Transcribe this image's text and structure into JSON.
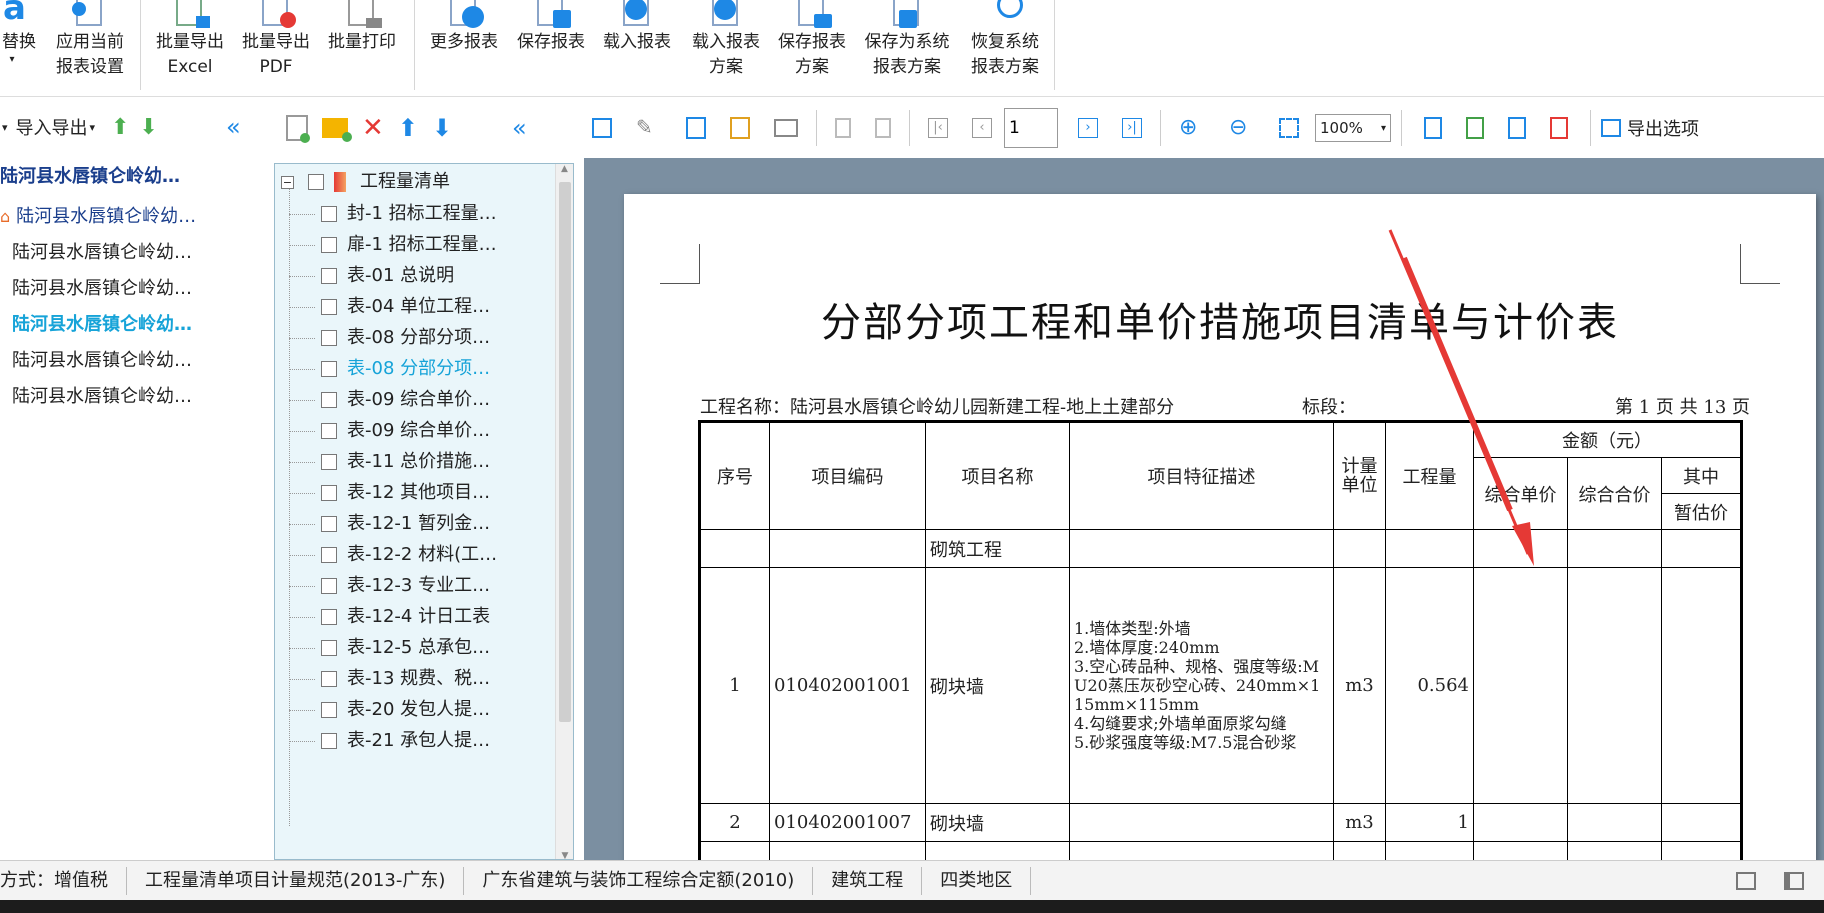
{
  "ribbon": {
    "buttons": [
      {
        "label1": "替换",
        "label2": "▾"
      },
      {
        "label1": "应用当前",
        "label2": "报表设置"
      },
      {
        "label1": "批量导出",
        "label2": "Excel"
      },
      {
        "label1": "批量导出",
        "label2": "PDF"
      },
      {
        "label1": "批量打印",
        "label2": ""
      },
      {
        "label1": "更多报表",
        "label2": ""
      },
      {
        "label1": "保存报表",
        "label2": ""
      },
      {
        "label1": "载入报表",
        "label2": ""
      },
      {
        "label1": "载入报表",
        "label2": "方案"
      },
      {
        "label1": "保存报表",
        "label2": "方案"
      },
      {
        "label1": "保存为系统",
        "label2": "报表方案"
      },
      {
        "label1": "恢复系统",
        "label2": "报表方案"
      }
    ]
  },
  "leftnav": {
    "import_export": "导入导出",
    "items": [
      "陆河县水唇镇仑岭幼…",
      "陆河县水唇镇仑岭幼…",
      "陆河县水唇镇仑岭幼…",
      "陆河县水唇镇仑岭幼…",
      "陆河县水唇镇仑岭幼…",
      "陆河县水唇镇仑岭幼…",
      "陆河县水唇镇仑岭幼…"
    ]
  },
  "tree": {
    "root": "工程量清单",
    "items": [
      "封-1 招标工程量…",
      "扉-1 招标工程量…",
      "表-01 总说明",
      "表-04 单位工程…",
      "表-08 分部分项…",
      "表-08 分部分项…",
      "表-09 综合单价…",
      "表-09 综合单价…",
      "表-11 总价措施…",
      "表-12 其他项目…",
      "表-12-1 暂列金…",
      "表-12-2 材料(工…",
      "表-12-3 专业工…",
      "表-12-4 计日工表",
      "表-12-5 总承包…",
      "表-13 规费、税…",
      "表-20 发包人提…",
      "表-21 承包人提…"
    ]
  },
  "toolbar": {
    "page_value": "1",
    "zoom": "100%",
    "export_options": "导出选项"
  },
  "report": {
    "title": "分部分项工程和单价措施项目清单与计价表",
    "project_name": "工程名称：陆河县水唇镇仑岭幼儿园新建工程-地上土建部分",
    "section": "标段：",
    "page_info": "第 1 页  共 13 页",
    "headers": {
      "seq": "序号",
      "code": "项目编码",
      "name": "项目名称",
      "desc": "项目特征描述",
      "unit": "计量单位",
      "qty": "工程量",
      "amount": "金额（元）",
      "unit_price": "综合单价",
      "total": "综合合价",
      "of_which": "其中",
      "provisional": "暂估价"
    },
    "group": "砌筑工程",
    "rows": [
      {
        "seq": "1",
        "code": "010402001001",
        "name": "砌块墙",
        "desc": "1.墙体类型:外墙\n2.墙体厚度:240mm\n3.空心砖品种、规格、强度等级:MU20蒸压灰砂空心砖、240mm×115mm×115mm\n4.勾缝要求;外墙单面原浆勾缝\n5.砂浆强度等级:M7.5混合砂浆",
        "unit": "m3",
        "qty": "0.564"
      },
      {
        "seq": "2",
        "code": "010402001007",
        "name": "砌块墙",
        "desc": "",
        "unit": "m3",
        "qty": "1"
      }
    ]
  },
  "status": {
    "items": [
      "方式：增值税",
      "工程量清单项目计量规范(2013-广东)",
      "广东省建筑与装饰工程综合定额(2010)",
      "建筑工程",
      "四类地区"
    ]
  },
  "colors": {
    "accent": "#1e88e5",
    "tree_bg": "#eaf6fa",
    "preview_bg": "#7b8fa1",
    "highlight": "#16a3d8",
    "arrow": "#e53935"
  }
}
